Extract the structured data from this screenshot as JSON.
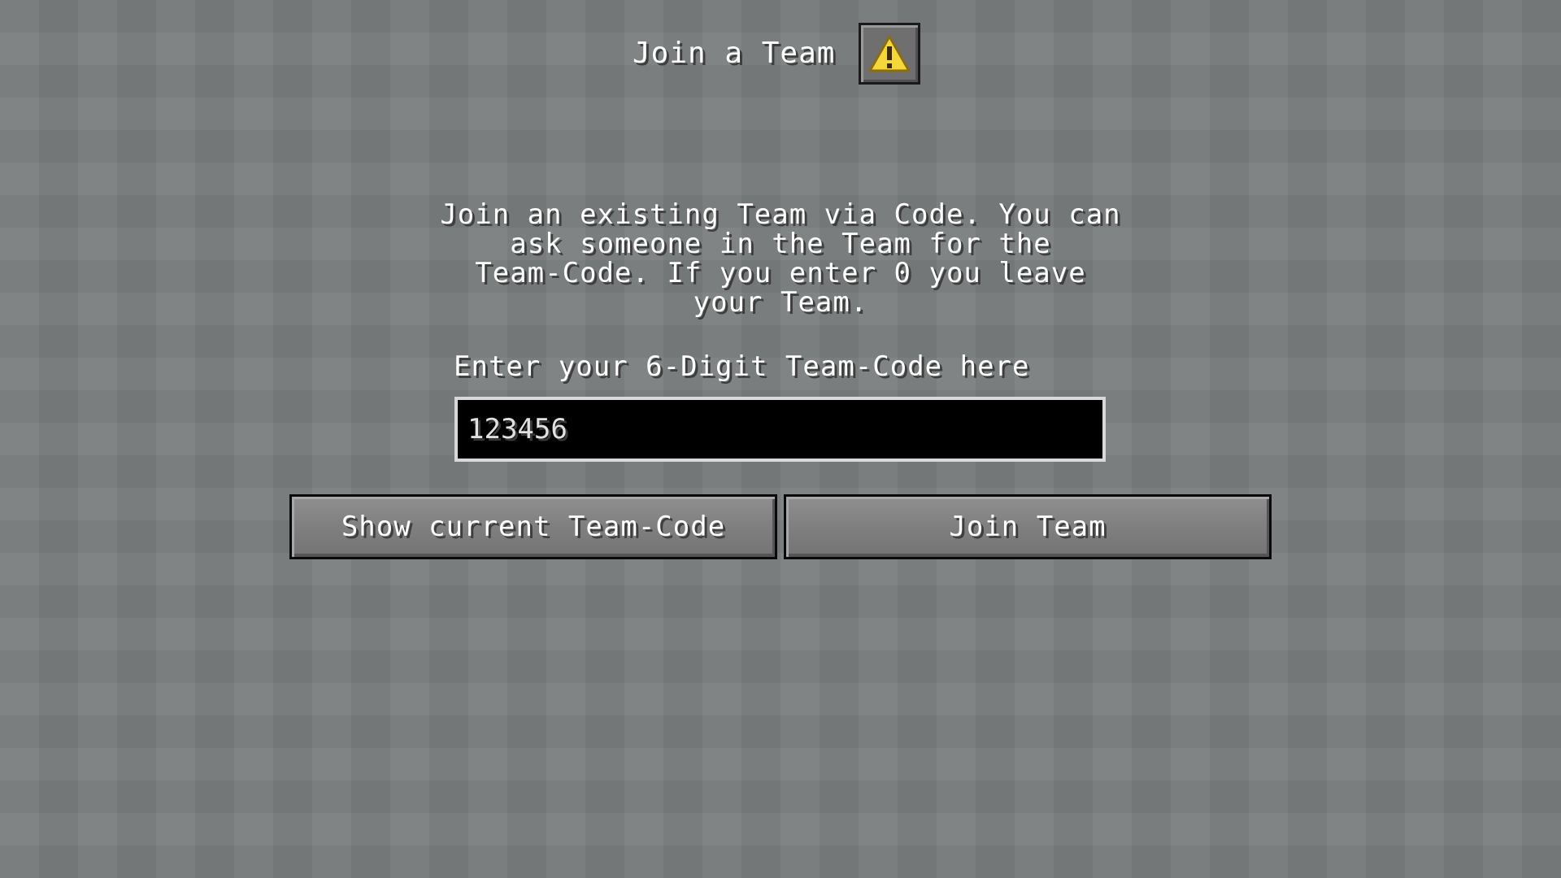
{
  "title": "Join a Team",
  "warning_icon": "warning-icon",
  "colors": {
    "background": "#7a7e7f",
    "warning_yellow": "#f4d83a",
    "input_bg": "#000000",
    "input_border": "#d8d8d8"
  },
  "description": "Join an existing Team via Code. You can\nask someone in the Team for the\nTeam-Code. If you enter 0 you leave\nyour Team.",
  "input": {
    "label": "Enter your 6-Digit Team-Code here",
    "value": "123456"
  },
  "buttons": {
    "show_code": "Show current Team-Code",
    "join": "Join Team"
  }
}
